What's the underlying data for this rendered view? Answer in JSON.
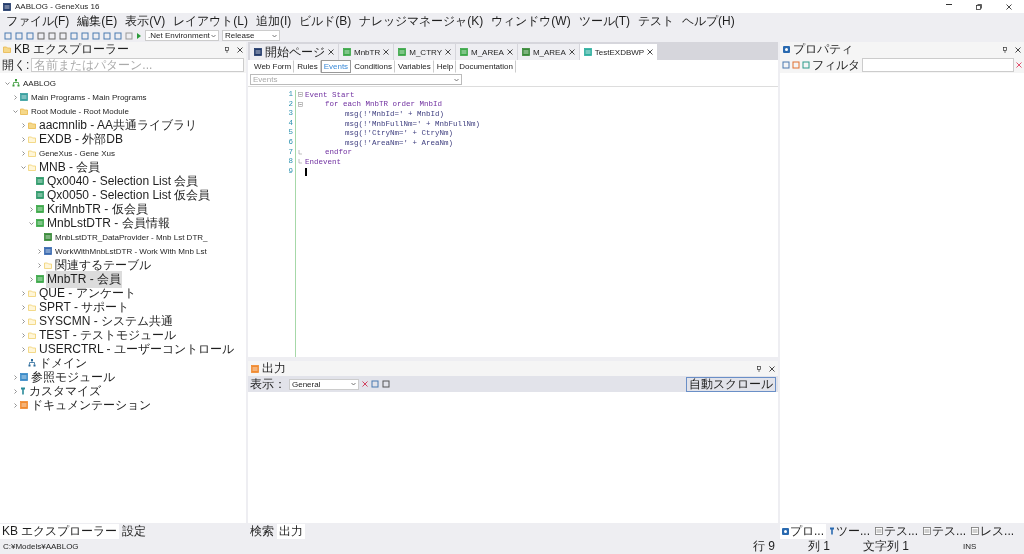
{
  "window": {
    "title": "AABLOG - GeneXus 16"
  },
  "menu": [
    "ファイル(F)",
    "編集(E)",
    "表示(V)",
    "レイアウト(L)",
    "追加(I)",
    "ビルド(B)",
    "ナレッジマネージャ(K)",
    "ウィンドウ(W)",
    "ツール(T)",
    "テスト",
    "ヘルプ(H)"
  ],
  "toolbar": {
    "environment": ".Net Environment",
    "configuration": "Release"
  },
  "explorer": {
    "title": "KB エクスプローラー",
    "filter_label": "開く:",
    "filter_placeholder": "名前またはパターン...",
    "tree": [
      {
        "label": "AABLOG",
        "kind": "kb",
        "expanded": true,
        "selected": false,
        "children": [
          {
            "label": "Main Programs - Main Programs",
            "kind": "program",
            "expanded": false,
            "selected": false
          },
          {
            "label": "Root Module - Root Module",
            "kind": "module",
            "expanded": true,
            "selected": false,
            "children": [
              {
                "label": "aacmnlib - AA共通ライブラリ",
                "kind": "module",
                "expanded": false,
                "selected": false
              },
              {
                "label": "EXDB - 外部DB",
                "kind": "folder",
                "expanded": false,
                "selected": false
              },
              {
                "label": "GeneXus - Gene Xus",
                "kind": "folder",
                "expanded": false,
                "selected": false
              },
              {
                "label": "MNB - 会員",
                "kind": "folder",
                "expanded": true,
                "selected": false,
                "children": [
                  {
                    "label": "Qx0040 - Selection List 会員",
                    "kind": "selection",
                    "selected": false
                  },
                  {
                    "label": "Qx0050 - Selection List 仮会員",
                    "kind": "selection",
                    "selected": false
                  },
                  {
                    "label": "KriMnbTR - 仮会員",
                    "kind": "transaction",
                    "expanded": false,
                    "selected": false
                  },
                  {
                    "label": "MnbLstDTR - 会員情報",
                    "kind": "transaction",
                    "expanded": true,
                    "selected": false,
                    "children": [
                      {
                        "label": "MnbLstDTR_DataProvider - Mnb Lst DTR_",
                        "kind": "dataprovider",
                        "selected": false
                      },
                      {
                        "label": "WorkWithMnbLstDTR - Work With Mnb Lst",
                        "kind": "workwith",
                        "expanded": false,
                        "selected": false
                      },
                      {
                        "label": "関連するテーブル",
                        "kind": "folder",
                        "expanded": false,
                        "selected": false
                      }
                    ]
                  },
                  {
                    "label": "MnbTR - 会員",
                    "kind": "transaction",
                    "expanded": false,
                    "selected": true
                  }
                ]
              },
              {
                "label": "QUE - アンケート",
                "kind": "folder",
                "expanded": false,
                "selected": false
              },
              {
                "label": "SPRT - サポート",
                "kind": "folder",
                "expanded": false,
                "selected": false
              },
              {
                "label": "SYSCMN - システム共通",
                "kind": "folder",
                "expanded": false,
                "selected": false
              },
              {
                "label": "TEST - テストモジュール",
                "kind": "folder",
                "expanded": false,
                "selected": false
              },
              {
                "label": "USERCTRL - ユーザーコントロール",
                "kind": "folder",
                "expanded": false,
                "selected": false
              },
              {
                "label": "ドメイン",
                "kind": "domain",
                "selected": false
              }
            ]
          },
          {
            "label": "参照モジュール",
            "kind": "reference",
            "expanded": false,
            "selected": false
          },
          {
            "label": "カスタマイズ",
            "kind": "customize",
            "expanded": false,
            "selected": false
          },
          {
            "label": "ドキュメンテーション",
            "kind": "doc",
            "expanded": false,
            "selected": false
          }
        ]
      }
    ],
    "bottom_tabs": [
      {
        "label": "KB エクスプローラー",
        "selected": true
      },
      {
        "label": "設定",
        "selected": false
      }
    ]
  },
  "documents": [
    {
      "label": "開始ページ",
      "kind": "start",
      "selected": false
    },
    {
      "label": "MnbTR",
      "kind": "transaction",
      "selected": false
    },
    {
      "label": "M_CTRY",
      "kind": "transaction",
      "selected": false
    },
    {
      "label": "M_AREA",
      "kind": "transaction",
      "selected": false
    },
    {
      "label": "M_AREA",
      "kind": "dataprovider",
      "selected": false
    },
    {
      "label": "TestEXDBWP",
      "kind": "webpanel",
      "selected": true
    }
  ],
  "parts": [
    {
      "label": "Web Form",
      "selected": false
    },
    {
      "label": "Rules",
      "selected": false
    },
    {
      "label": "Events",
      "selected": true
    },
    {
      "label": "Conditions",
      "selected": false
    },
    {
      "label": "Variables",
      "selected": false
    },
    {
      "label": "Help",
      "selected": false
    },
    {
      "label": "Documentation",
      "selected": false
    }
  ],
  "events_combo": {
    "placeholder": "Events"
  },
  "code": [
    {
      "number": "1",
      "text": "Event Start",
      "kind": "keyword",
      "children": [
        {
          "number": "2",
          "text": "for each MnbTR order MnbId",
          "kind": "keyword",
          "children": [
            {
              "number": "3",
              "text": "msg(!'MnbId=' + MnbId)",
              "kind": "statement"
            },
            {
              "number": "4",
              "text": "msg(!'MnbFullNm=' + MnbFullNm)",
              "kind": "statement"
            },
            {
              "number": "5",
              "text": "msg(!'CtryNm=' + CtryNm)",
              "kind": "statement"
            },
            {
              "number": "6",
              "text": "msg(!'AreaNm=' + AreaNm)",
              "kind": "statement"
            }
          ]
        },
        {
          "number": "7",
          "text": "endfor",
          "kind": "end"
        }
      ]
    },
    {
      "number": "8",
      "text": "Endevent",
      "kind": "end"
    },
    {
      "number": "9",
      "kind": "cursor"
    }
  ],
  "output": {
    "title": "出力",
    "show_label": "表示：",
    "show_value": "General",
    "autoscroll": "自動スクロール",
    "bottom_tabs": [
      {
        "label": "検索",
        "selected": false
      },
      {
        "label": "出力",
        "selected": true
      }
    ]
  },
  "properties": {
    "title": "プロパティ",
    "filter_label": "フィルタ",
    "bottom_tabs": [
      {
        "label": "プロ...",
        "kind": "gear",
        "selected": true
      },
      {
        "label": "ツー...",
        "kind": "tool",
        "selected": false
      },
      {
        "label": "テス...",
        "kind": "test",
        "selected": false
      },
      {
        "label": "テス...",
        "kind": "list",
        "selected": false
      },
      {
        "label": "レス...",
        "kind": "grid",
        "selected": false
      }
    ]
  },
  "status_bar": {
    "path": "C:¥Models¥AABLOG",
    "line": "行 9",
    "column": "列 1",
    "char": "文字列 1",
    "mode": "INS"
  }
}
